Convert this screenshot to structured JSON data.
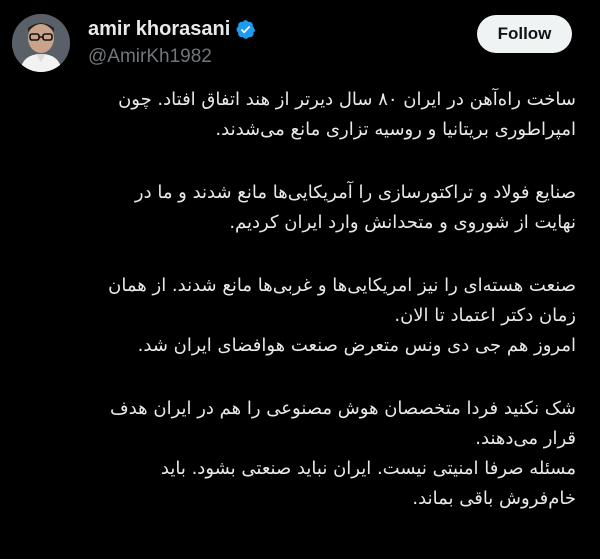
{
  "author": {
    "display_name": "amir khorasani",
    "handle": "@AmirKh1982",
    "avatar_icon": "profile-photo",
    "verified_icon": "verified-badge-icon",
    "verified_color": "#1d9bf0"
  },
  "follow_button": {
    "label": "Follow"
  },
  "tweet": {
    "lines": [
      "ساخت راه‌آهن در ایران ۸۰ سال دیرتر از هند اتفاق افتاد. چون",
      "امپراطوری بریتانیا و روسیه تزاری مانع می‌شدند.",
      "",
      "صنایع فولاد و تراکتورسازی را آمریکایی‌ها مانع شدند و ما در",
      "نهایت از شوروی و متحدانش وارد ایران کردیم.",
      "",
      "صنعت هسته‌ای را نیز امریکایی‌ها و غربی‌ها مانع شدند. از همان",
      "زمان دکتر اعتماد تا الان.",
      "امروز هم جی دی ونس متعرض صنعت هوافضای ایران شد.",
      "",
      "شک نکنید فردا متخصصان هوش مصنوعی را هم در ایران هدف",
      "قرار می‌دهند.",
      "مسئله صرفا امنیتی نیست. ایران نباید صنعتی بشود. باید",
      "خام‌فروش باقی بماند."
    ]
  },
  "colors": {
    "background": "#000000",
    "text": "#e7e9ea",
    "secondary_text": "#71767b",
    "button_bg": "#eff3f4"
  }
}
